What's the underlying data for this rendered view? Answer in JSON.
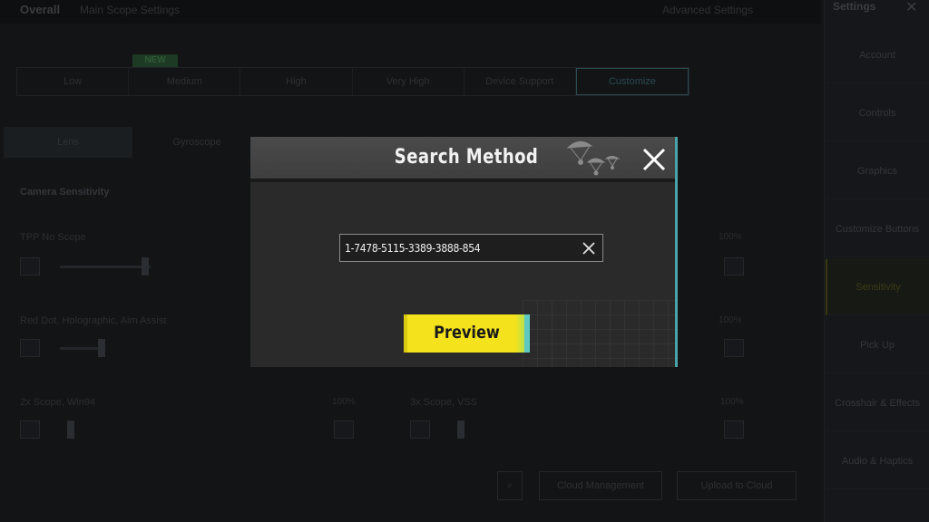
{
  "background": {
    "top_title": "Overall",
    "top_subtitle": "Main Scope Settings",
    "top_right": "Advanced Settings",
    "sidebar_title": "Settings",
    "sidebar_items": [
      "Account",
      "Controls",
      "Graphics",
      "Customize Buttons",
      "Sensitivity",
      "Pick Up",
      "Crosshair & Effects",
      "Audio & Haptics"
    ],
    "badge": "NEW",
    "tabs": [
      "Low",
      "Medium",
      "High",
      "Very High",
      "Device Support",
      "Customize"
    ],
    "subtabs": [
      "Lens",
      "Gyroscope"
    ],
    "section_label": "Camera Sensitivity",
    "labels": [
      "TPP No Scope",
      "Red Dot, Holographic, Aim Assist",
      "2x Scope, Win94",
      "3x Scope, VSS"
    ],
    "percents": [
      "100%",
      "100%",
      "100%",
      "100%",
      "100%",
      "100%"
    ],
    "buttons": [
      "Cloud Management",
      "Upload to Cloud"
    ]
  },
  "modal": {
    "title": "Search Method",
    "search": {
      "value": "1-7478-5115-3389-3888-854",
      "placeholder": ""
    },
    "preview_label": "Preview"
  },
  "icons": {
    "close": "close-icon",
    "clear": "clear-icon",
    "parachute": "parachute-icon"
  },
  "colors": {
    "accent_yellow": "#f4e31c",
    "accent_cyan": "#4aa3a8",
    "modal_bg": "#2a2a2a"
  }
}
